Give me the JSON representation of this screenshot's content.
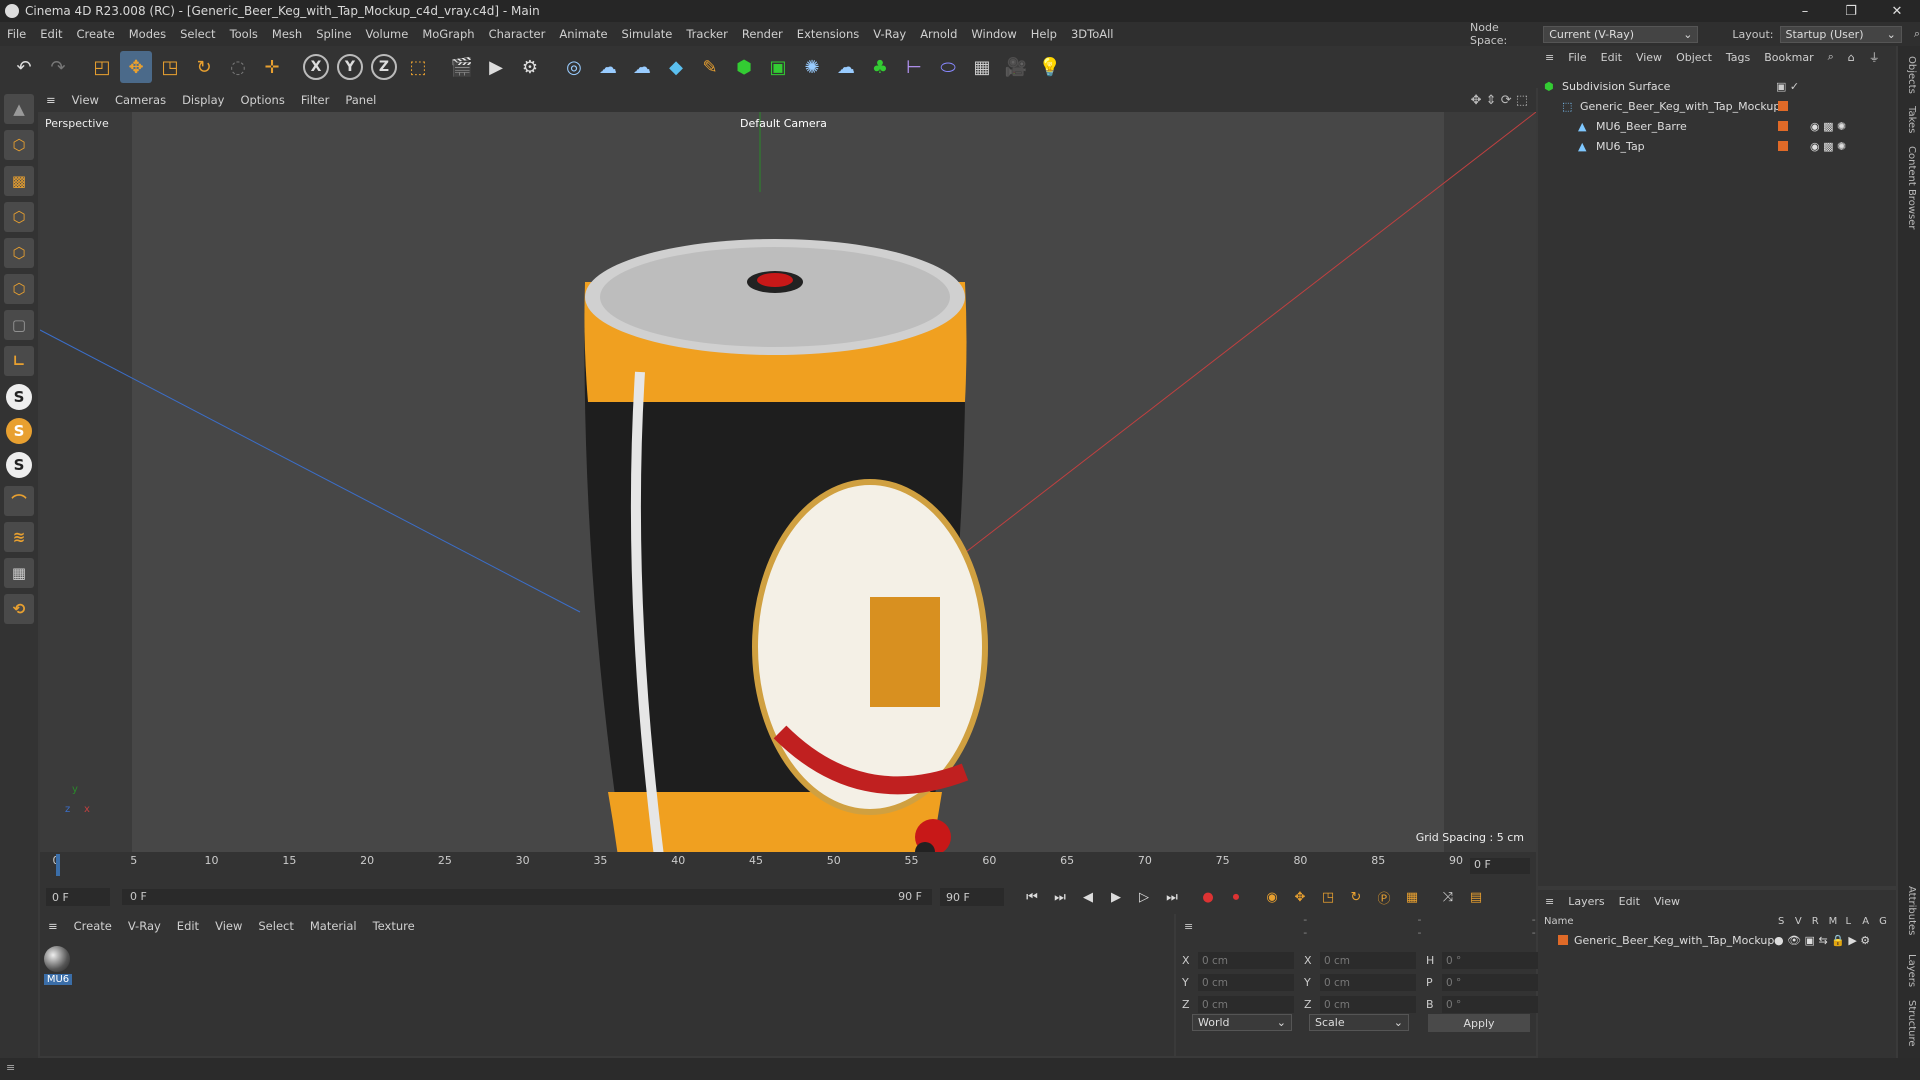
{
  "window": {
    "title": "Cinema 4D R23.008 (RC) - [Generic_Beer_Keg_with_Tap_Mockup_c4d_vray.c4d] - Main"
  },
  "menubar": {
    "items": [
      "File",
      "Edit",
      "Create",
      "Modes",
      "Select",
      "Tools",
      "Mesh",
      "Spline",
      "Volume",
      "MoGraph",
      "Character",
      "Animate",
      "Simulate",
      "Tracker",
      "Render",
      "Extensions",
      "V-Ray",
      "Arnold",
      "Window",
      "Help",
      "3DToAll"
    ],
    "node_space_label": "Node Space:",
    "node_space_value": "Current (V-Ray)",
    "layout_label": "Layout:",
    "layout_value": "Startup (User)"
  },
  "viewport": {
    "menu": [
      "View",
      "Cameras",
      "Display",
      "Options",
      "Filter",
      "Panel"
    ],
    "label": "Perspective",
    "camera": "Default Camera",
    "grid_spacing": "Grid Spacing : 5 cm",
    "axis_y": "y",
    "axis_z": "z",
    "axis_x": "x"
  },
  "timeline": {
    "ticks": [
      "0",
      "5",
      "10",
      "15",
      "20",
      "25",
      "30",
      "35",
      "40",
      "45",
      "50",
      "55",
      "60",
      "65",
      "70",
      "75",
      "80",
      "85",
      "90"
    ],
    "current_frame": "0 F",
    "start": "0 F",
    "range_start": "0 F",
    "range_end": "90 F",
    "end": "90 F"
  },
  "material_panel": {
    "menu": [
      "Create",
      "V-Ray",
      "Edit",
      "View",
      "Select",
      "Material",
      "Texture"
    ],
    "material_name": "MU6"
  },
  "coords": {
    "header_dash": "--",
    "x_pos": "0 cm",
    "y_pos": "0 cm",
    "z_pos": "0 cm",
    "x_size": "0 cm",
    "y_size": "0 cm",
    "z_size": "0 cm",
    "h": "0 °",
    "p": "0 °",
    "b": "0 °",
    "mode": "World",
    "scale": "Scale",
    "apply": "Apply"
  },
  "objects": {
    "menu": [
      "File",
      "Edit",
      "View",
      "Object",
      "Tags",
      "Bookmar"
    ],
    "items": [
      {
        "name": "Subdivision Surface"
      },
      {
        "name": "Generic_Beer_Keg_with_Tap_Mockup"
      },
      {
        "name": "MU6_Beer_Barre"
      },
      {
        "name": "MU6_Tap"
      }
    ]
  },
  "layers": {
    "menu": [
      "Layers",
      "Edit",
      "View"
    ],
    "columns": [
      "Name",
      "S",
      "V",
      "R",
      "M",
      "L",
      "A",
      "G"
    ],
    "row": "Generic_Beer_Keg_with_Tap_Mockup"
  },
  "sidetabs": [
    "Objects",
    "Takes",
    "Content Browser",
    "Attributes",
    "Layers",
    "Structure"
  ],
  "colors": {
    "accent_orange": "#e8a030",
    "tag_orange": "#e06a28",
    "selection_blue": "#3b6ea8"
  }
}
